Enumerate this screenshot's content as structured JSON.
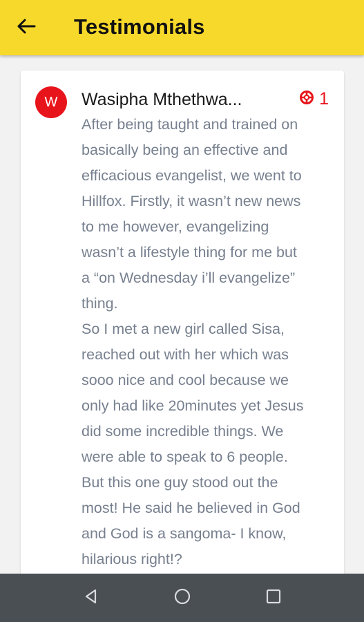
{
  "header": {
    "title": "Testimonials",
    "back_icon": "arrow-left-icon"
  },
  "colors": {
    "appbar": "#f7d92b",
    "accent": "#e8141b",
    "body_text": "#77808f",
    "navbar": "#4a4f54"
  },
  "testimonial": {
    "avatar_letter": "W",
    "author": "Wasipha Mthethwa...",
    "count_icon": "lifebuoy-icon",
    "count": "1",
    "lines": [
      "After being taught and trained on",
      "basically being an effective and",
      "efficacious evangelist, we went to",
      "Hillfox. Firstly, it wasn’t new news",
      "to me however, evangelizing",
      "wasn’t a lifestyle thing for me but",
      "a “on Wednesday i’ll evangelize”",
      "thing.",
      "So I met a new girl called Sisa,",
      "reached out with her which was",
      "sooo nice and cool because we",
      "only had like 20minutes yet Jesus",
      "did some incredible things. We",
      "were able to speak to 6 people.",
      "But this one guy stood out the",
      "most! He said he believed in God",
      "and God is a sangoma- I know,",
      "hilarious right!?"
    ]
  },
  "system_nav": {
    "back": "triangle-back-icon",
    "home": "circle-home-icon",
    "recents": "square-recents-icon"
  }
}
